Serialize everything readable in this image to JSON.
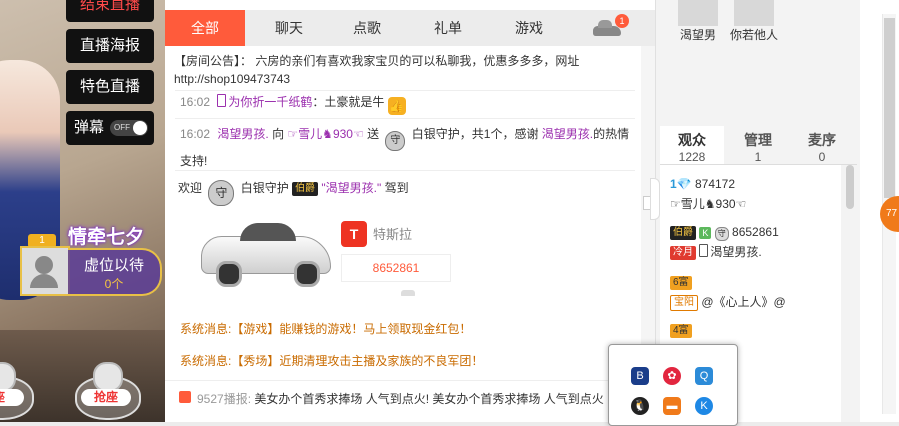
{
  "left": {
    "buttons": {
      "fans": "结束直播",
      "poster": "直播海报",
      "special": "特色直播",
      "danmu": "弹幕",
      "toggle": "OFF"
    },
    "seat1": {
      "crown": "1",
      "title": "情牵七夕",
      "name": "虚位以待",
      "count": "0个"
    },
    "grab": [
      "座",
      "抢座"
    ]
  },
  "chat": {
    "tabs": [
      "全部",
      "聊天",
      "点歌",
      "礼单",
      "游戏"
    ],
    "car_badge": "1",
    "notice": "【房间公告】： 六房的亲们有喜欢我家宝贝的可以私聊我，优惠多多多，网址http://shop109473743",
    "messages": [
      {
        "time": "16:02",
        "user": "为你折一千纸鹤",
        "sep": "：",
        "text": "土豪就是牛"
      },
      {
        "time": "16:02",
        "from": "渴望男孩.",
        "to_word": "向",
        "to": "☞雪儿♞930☜",
        "send": "送",
        "item": "白银守护，共1个，感谢",
        "thank": "渴望男孩.",
        "end": "的热情支持!"
      },
      {
        "welcome": "欢迎",
        "item": "白银守护",
        "vip": "伯爵",
        "user": "\"渴望男孩.\"",
        "arrive": "驾到"
      }
    ],
    "car_gift": {
      "brand_logo": "T",
      "brand": "特斯拉",
      "id": "8652861"
    },
    "system": [
      {
        "prefix": "系统消息:",
        "tag": "【游戏】",
        "text": "能赚钱的游戏！马上领取现金红包！"
      },
      {
        "prefix": "系统消息:",
        "tag": "【秀场】",
        "text": "近期清理攻击主播及家族的不良军团！"
      }
    ],
    "broadcast": {
      "uid": "9527播报:",
      "text": "美女办个首秀求捧场 人气到点火! 美女办个首秀求捧场 人气到点火"
    }
  },
  "right": {
    "top_users": [
      "渴望男",
      "你若他人"
    ],
    "tabs": [
      {
        "label": "观众",
        "count": "1228"
      },
      {
        "label": "管理",
        "count": "1"
      },
      {
        "label": "麦序",
        "count": "0"
      }
    ],
    "audience": [
      {
        "level": "1",
        "num": "874172",
        "name": "☞雪儿♞930☜"
      },
      {
        "vip": "伯爵",
        "k": "K",
        "guard": "守",
        "num": "8652861",
        "tag": "冷月",
        "name": "渴望男孩."
      },
      {
        "badge": "6富",
        "tag": "宝阳",
        "name": "@《心上人》@"
      },
      {
        "badge": "4富"
      }
    ]
  },
  "float_ball": "77",
  "tray": [
    "B",
    "✿",
    "Q",
    "🐧",
    "▬",
    "K"
  ]
}
